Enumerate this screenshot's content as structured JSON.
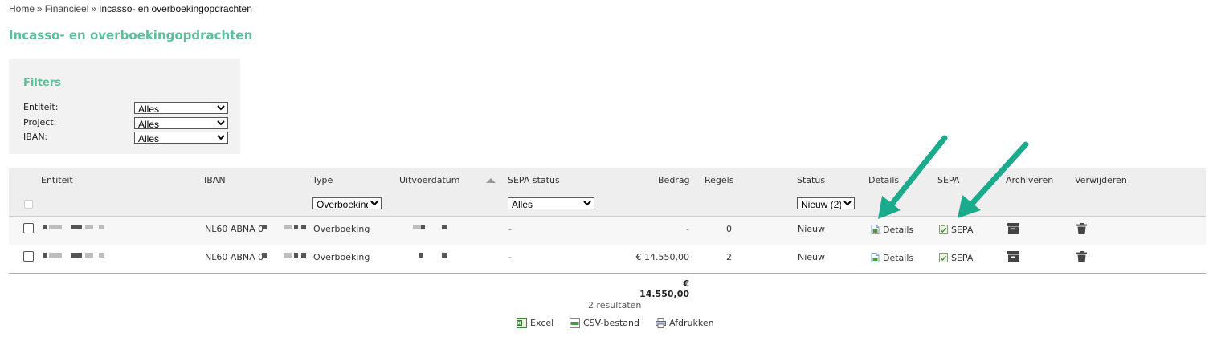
{
  "breadcrumb": {
    "home": "Home",
    "sep": "»",
    "financieel": "Financieel",
    "current": "Incasso- en overboekingopdrachten"
  },
  "page_title": "Incasso- en overboekingopdrachten",
  "filters": {
    "title": "Filters",
    "entiteit": {
      "label": "Entiteit:",
      "value": "Alles"
    },
    "project": {
      "label": "Project:",
      "value": "Alles"
    },
    "iban": {
      "label": "IBAN:",
      "value": "Alles"
    }
  },
  "table": {
    "headers": {
      "entiteit": "Entiteit",
      "iban": "IBAN",
      "type": "Type",
      "uitvoerdatum": "Uitvoerdatum",
      "sepa_status": "SEPA status",
      "bedrag": "Bedrag",
      "regels": "Regels",
      "status": "Status",
      "details": "Details",
      "sepa": "SEPA",
      "archiveren": "Archiveren",
      "verwijderen": "Verwijderen"
    },
    "column_filters": {
      "type": "Overboeking",
      "sepa_status": "Alles",
      "status": "Nieuw (2)"
    },
    "rows": [
      {
        "iban": "NL60 ABNA 0",
        "type": "Overboeking",
        "sepa_status": "-",
        "bedrag": "-",
        "regels": "0",
        "status": "Nieuw",
        "details": "Details",
        "sepa": "SEPA"
      },
      {
        "iban": "NL60 ABNA 0",
        "type": "Overboeking",
        "sepa_status": "-",
        "bedrag": "€ 14.550,00",
        "regels": "2",
        "status": "Nieuw",
        "details": "Details",
        "sepa": "SEPA"
      }
    ],
    "total": "€ 14.550,00",
    "results": "2 resultaten"
  },
  "export": {
    "excel": "Excel",
    "csv": "CSV-bestand",
    "print": "Afdrukken"
  },
  "colors": {
    "accent": "#5bbf99",
    "arrow": "#1aaa8c"
  }
}
